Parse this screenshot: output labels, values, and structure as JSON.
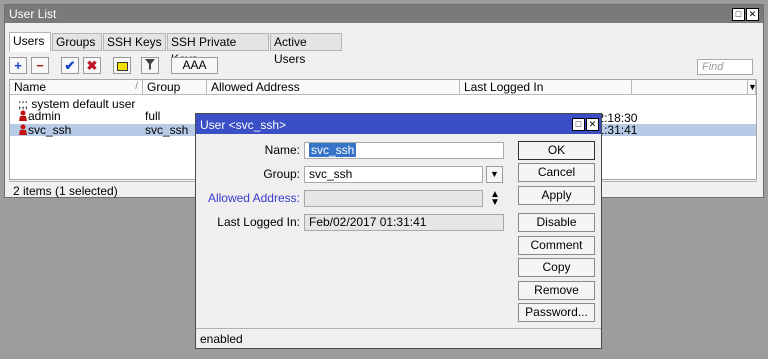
{
  "window": {
    "title": "User List",
    "tabs": [
      "Users",
      "Groups",
      "SSH Keys",
      "SSH Private Keys",
      "Active Users"
    ],
    "toolbar": {
      "aaa_label": "AAA",
      "find_placeholder": "Find"
    },
    "table": {
      "headers": [
        "Name",
        "Group",
        "Allowed Address",
        "Last Logged In"
      ],
      "comment": ";;; system default user",
      "rows": [
        {
          "name": "admin",
          "group": "full",
          "allowed": "",
          "last": "Feb/01/2017 02:18:30"
        },
        {
          "name": "svc_ssh",
          "group": "svc_ssh",
          "allowed": "",
          "last": "Feb/02/2017 01:31:41",
          "selected": true
        }
      ]
    },
    "status": "2 items (1 selected)"
  },
  "dialog": {
    "title": "User <svc_ssh>",
    "fields": {
      "name_label": "Name:",
      "name_value": "svc_ssh",
      "group_label": "Group:",
      "group_value": "svc_ssh",
      "allowed_label": "Allowed Address:",
      "allowed_value": "",
      "last_label": "Last Logged In:",
      "last_value": "Feb/02/2017 01:31:41"
    },
    "buttons": [
      "OK",
      "Cancel",
      "Apply",
      "Disable",
      "Comment",
      "Copy",
      "Remove",
      "Password..."
    ],
    "status": "enabled"
  },
  "colors": {
    "dialog_title": "#3a4ec5",
    "selected_row": "#b7cbe6",
    "link_label": "#3a3acb"
  }
}
